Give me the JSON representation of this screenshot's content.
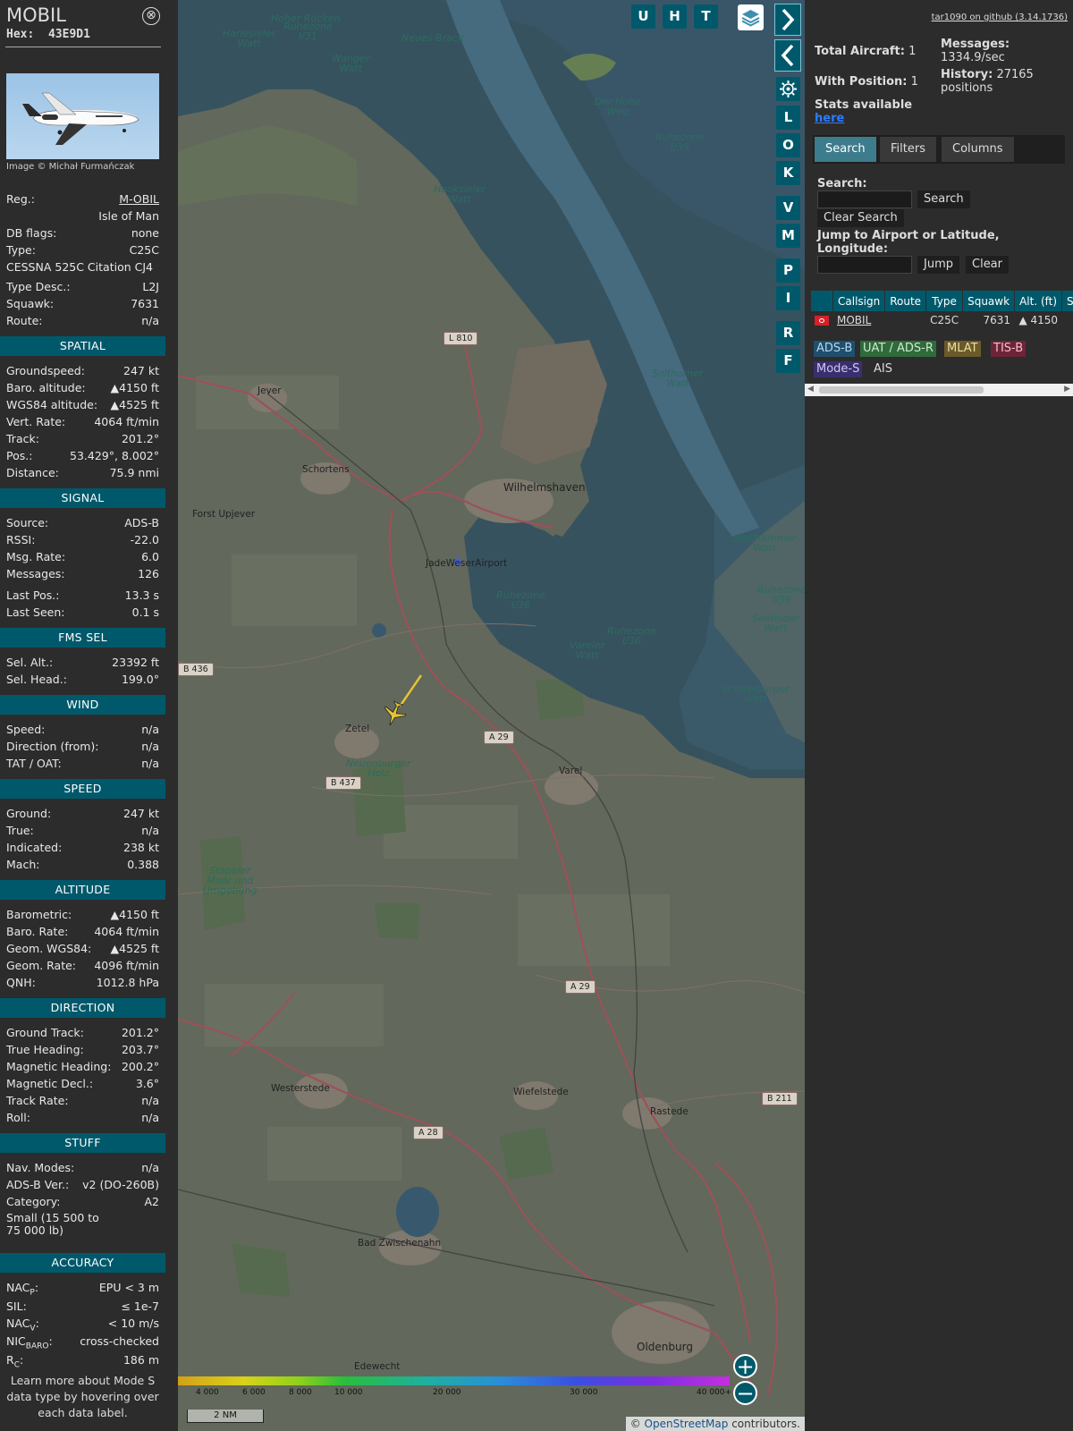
{
  "aircraft": {
    "callsign": "MOBIL",
    "hex_label": "Hex:",
    "hex": "43E9D1",
    "photo_credit": "Image © Michał Furmańczak",
    "close": "⊗",
    "details": [
      {
        "k": "Reg.:",
        "v": "M-OBIL",
        "link": true
      },
      {
        "k": "",
        "v": "Isle of Man"
      },
      {
        "k": "DB flags:",
        "v": "none"
      },
      {
        "k": "Type:",
        "v": "C25C"
      },
      {
        "k": "CESSNA 525C Citation CJ4",
        "v": ""
      },
      {
        "k": "Type Desc.:",
        "v": "L2J"
      },
      {
        "k": "Squawk:",
        "v": "7631"
      },
      {
        "k": "Route:",
        "v": "n/a"
      }
    ],
    "sections": [
      {
        "title": "SPATIAL",
        "rows": [
          {
            "k": "Groundspeed:",
            "v": "247 kt"
          },
          {
            "k": "Baro. altitude:",
            "v": "▲4150 ft"
          },
          {
            "k": "WGS84 altitude:",
            "v": "▲4525 ft"
          },
          {
            "k": "Vert. Rate:",
            "v": "4064 ft/min"
          },
          {
            "k": "Track:",
            "v": "201.2°"
          },
          {
            "k": "Pos.:",
            "v": "53.429°, 8.002°"
          },
          {
            "k": "Distance:",
            "v": "75.9 nmi"
          }
        ]
      },
      {
        "title": "SIGNAL",
        "rows": [
          {
            "k": "Source:",
            "v": "ADS-B"
          },
          {
            "k": "RSSI:",
            "v": "-22.0"
          },
          {
            "k": "Msg. Rate:",
            "v": "6.0"
          },
          {
            "k": "Messages:",
            "v": "126"
          },
          {
            "k": "Last Pos.:",
            "v": "13.3 s"
          },
          {
            "k": "Last Seen:",
            "v": "0.1 s"
          }
        ]
      },
      {
        "title": "FMS SEL",
        "rows": [
          {
            "k": "Sel. Alt.:",
            "v": "23392 ft"
          },
          {
            "k": "Sel. Head.:",
            "v": "199.0°"
          }
        ]
      },
      {
        "title": "WIND",
        "rows": [
          {
            "k": "Speed:",
            "v": "n/a"
          },
          {
            "k": "Direction (from):",
            "v": "n/a"
          },
          {
            "k": "TAT / OAT:",
            "v": "n/a"
          }
        ]
      },
      {
        "title": "SPEED",
        "rows": [
          {
            "k": "Ground:",
            "v": "247 kt"
          },
          {
            "k": "True:",
            "v": "n/a"
          },
          {
            "k": "Indicated:",
            "v": "238 kt"
          },
          {
            "k": "Mach:",
            "v": "0.388"
          }
        ]
      },
      {
        "title": "ALTITUDE",
        "rows": [
          {
            "k": "Barometric:",
            "v": "▲4150 ft"
          },
          {
            "k": "Baro. Rate:",
            "v": "4064 ft/min"
          },
          {
            "k": "Geom. WGS84:",
            "v": "▲4525 ft"
          },
          {
            "k": "Geom. Rate:",
            "v": "4096 ft/min"
          },
          {
            "k": "QNH:",
            "v": "1012.8 hPa"
          }
        ]
      },
      {
        "title": "DIRECTION",
        "rows": [
          {
            "k": "Ground Track:",
            "v": "201.2°"
          },
          {
            "k": "True Heading:",
            "v": "203.7°"
          },
          {
            "k": "Magnetic Heading:",
            "v": "200.2°"
          },
          {
            "k": "Magnetic Decl.:",
            "v": "3.6°"
          },
          {
            "k": "Track Rate:",
            "v": "n/a"
          },
          {
            "k": "Roll:",
            "v": "n/a"
          }
        ]
      },
      {
        "title": "STUFF",
        "rows": [
          {
            "k": "Nav. Modes:",
            "v": "n/a"
          },
          {
            "k": "ADS-B Ver.:",
            "v": "v2 (DO-260B)"
          },
          {
            "k": "Category:",
            "v": "A2"
          },
          {
            "k": "Small (15 500 to 75 000 lb)",
            "v": "",
            "wrap": true
          }
        ]
      },
      {
        "title": "ACCURACY",
        "rows": [
          {
            "k": "NAC",
            "sub": "P",
            "suffix": ":",
            "v": "EPU < 3 m"
          },
          {
            "k": "SIL:",
            "v": "≤ 1e-7"
          },
          {
            "k": "NAC",
            "sub": "V",
            "suffix": ":",
            "v": "< 10 m/s"
          },
          {
            "k": "NIC",
            "sub": "BARO",
            "suffix": ":",
            "v": "cross-checked"
          },
          {
            "k": "R",
            "sub": "C",
            "suffix": ":",
            "v": "186 m"
          }
        ]
      }
    ],
    "footnote": "Learn more about Mode S data type by hovering over each data label."
  },
  "map": {
    "layer_buttons": [
      "U",
      "H",
      "T"
    ],
    "side_buttons": [
      "L",
      "O",
      "K",
      "V",
      "M",
      "P",
      "I",
      "R",
      "F"
    ],
    "labels": [
      {
        "t": "Hoher Rücken",
        "water": true
      },
      {
        "t": "Ruhezone\nI/31",
        "water": true
      },
      {
        "t": "Harlesieler\nWatt",
        "water": true
      },
      {
        "t": "Neues Brack",
        "water": true
      },
      {
        "t": "Wanger\nWatt",
        "water": true
      },
      {
        "t": "Der Hohe\nWeg",
        "water": true
      },
      {
        "t": "Ruhezone\nI/39",
        "water": true
      },
      {
        "t": "Hooksieler\nWatt",
        "water": true
      },
      {
        "t": "Jever"
      },
      {
        "t": "Schortens"
      },
      {
        "t": "Wilhelmshaven"
      },
      {
        "t": "Forst Upjever"
      },
      {
        "t": "Solthorner\nWatt",
        "water": true
      },
      {
        "t": "JadeWeserAirport"
      },
      {
        "t": "Ruhezone\nI/36",
        "water": true
      },
      {
        "t": "Stollhammer\nWatt",
        "water": true
      },
      {
        "t": "Ruhezone\nI/38",
        "water": true
      },
      {
        "t": "Seefelder\nWatt",
        "water": true
      },
      {
        "t": "Vareler\nWatt",
        "water": true
      },
      {
        "t": "Ruhezone\nI/36",
        "water": true
      },
      {
        "t": "Schweiburger\nWatt",
        "water": true
      },
      {
        "t": "Zetel"
      },
      {
        "t": "Varel"
      },
      {
        "t": "Neuenburger\nHolz",
        "water": true
      },
      {
        "t": "Stapeler\nMoor und\nUmgebung",
        "water": true
      },
      {
        "t": "Westerstede"
      },
      {
        "t": "Wiefelstede"
      },
      {
        "t": "Rastede"
      },
      {
        "t": "Bad Zwischenahn"
      },
      {
        "t": "Oldenburg"
      },
      {
        "t": "Edewecht"
      }
    ],
    "shields": [
      "L 810",
      "B 436",
      "A 29",
      "B 437",
      "A 29",
      "A 28",
      "B 211"
    ],
    "altitude_ticks": [
      "4 000",
      "6 000",
      "8 000",
      "10 000",
      "20 000",
      "30 000",
      "40 000+"
    ],
    "scale": "2 NM",
    "attribution_prefix": "© ",
    "attribution_link": "OpenStreetMap",
    "attribution_suffix": " contributors."
  },
  "right": {
    "github": "tar1090 on github (3.14.1736)",
    "total_aircraft_label": "Total Aircraft:",
    "total_aircraft": "1",
    "with_position_label": "With Position:",
    "with_position": "1",
    "stats_label": "Stats available",
    "stats_link": "here",
    "messages_label": "Messages:",
    "messages": "1334.9/sec",
    "history_label": "History:",
    "history": "27165 positions",
    "tabs": [
      "Search",
      "Filters",
      "Columns"
    ],
    "search_label": "Search:",
    "search_button": "Search",
    "clear_search_button": "Clear Search",
    "jump_label": "Jump to Airport or Latitude, Longitude:",
    "jump_button": "Jump",
    "clear_button": "Clear",
    "columns": [
      "",
      "Callsign",
      "Route",
      "Type",
      "Squawk",
      "Alt. (ft)",
      "Spd"
    ],
    "rows": [
      {
        "flag": "",
        "callsign": "MOBIL",
        "route": "",
        "type": "C25C",
        "squawk": "7631",
        "alt": "▲ 4150",
        "spd": ""
      }
    ],
    "legend": [
      {
        "t": "ADS-B",
        "bg": "#1f4f6e",
        "fg": "#b6d6ee"
      },
      {
        "t": "UAT / ADS-R",
        "bg": "#2f6b3b",
        "fg": "#cfe8cf"
      },
      {
        "t": "MLAT",
        "bg": "#6b5a2a",
        "fg": "#f1dca0"
      },
      {
        "t": "TIS-B",
        "bg": "#6e2437",
        "fg": "#f4bfcb"
      },
      {
        "t": "Mode-S",
        "bg": "#3a2f6e",
        "fg": "#d0c8f4"
      },
      {
        "t": "AIS",
        "bg": "#2c2c2c",
        "fg": "#dddddd"
      }
    ]
  }
}
